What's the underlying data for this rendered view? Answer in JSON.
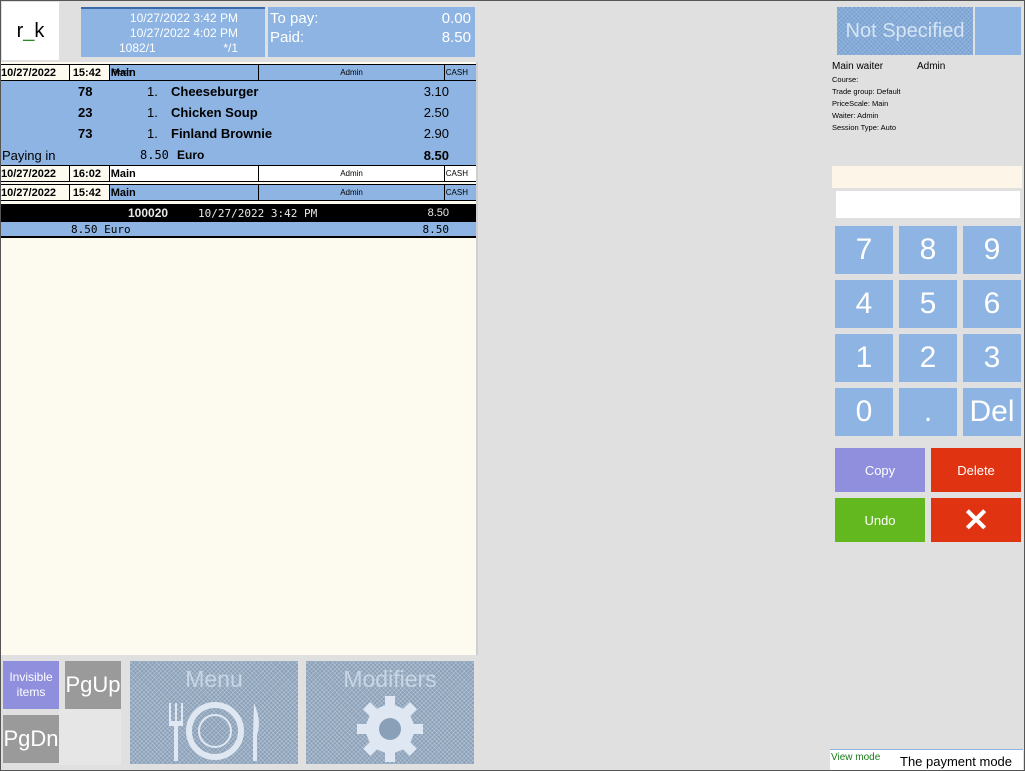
{
  "header": {
    "logo": {
      "left": "r",
      "underscore": "_",
      "right": "k"
    },
    "order_info": {
      "opened": "10/27/2022 3:42 PM",
      "closed": "10/27/2022 4:02 PM",
      "order_number": "1082/1",
      "guests": "*/1"
    },
    "payment": {
      "to_pay_label": "To pay:",
      "to_pay_value": "0.00",
      "paid_label": "Paid:",
      "paid_value": "8.50"
    }
  },
  "order": {
    "rows": [
      {
        "date": "10/27/2022",
        "time": "15:42",
        "status": "Ready",
        "menu": "Main",
        "waiter": "Admin",
        "payment": "CASH"
      },
      {
        "date": "10/27/2022",
        "time": "16:02",
        "status": "",
        "menu": "Main",
        "waiter": "Admin",
        "payment": "CASH"
      },
      {
        "date": "10/27/2022",
        "time": "15:42",
        "status": "",
        "menu": "Main",
        "waiter": "Admin",
        "payment": "CASH"
      }
    ],
    "items": [
      {
        "code": "78",
        "qty": "1.",
        "name": "Cheeseburger",
        "price": "3.10"
      },
      {
        "code": "23",
        "qty": "1.",
        "name": "Chicken Soup",
        "price": "2.50"
      },
      {
        "code": "73",
        "qty": "1.",
        "name": "Finland Brownie",
        "price": "2.90"
      }
    ],
    "paying_in": {
      "label": "Paying in",
      "amount": "8.50",
      "currency": "Euro",
      "total": "8.50"
    },
    "receipt": {
      "number": "100020",
      "datetime": "10/27/2022 3:42 PM",
      "amount": "8.50"
    },
    "receipt_total": {
      "amount": "8.50 Euro",
      "total": "8.50"
    }
  },
  "bottom": {
    "invisible_items": "Invisible items",
    "pgup": "PgUp",
    "pgdn": "PgDn",
    "menu": "Menu",
    "modifiers": "Modifiers"
  },
  "right": {
    "guest_type": "Not Specified",
    "main_waiter_label": "Main waiter",
    "main_waiter_value": "Admin",
    "course": "Course:",
    "trade_group": "Trade group: Default",
    "price_scale": "PriceScale: Main",
    "waiter": "Waiter: Admin",
    "session_type": "Session Type: Auto",
    "keypad": [
      "7",
      "8",
      "9",
      "4",
      "5",
      "6",
      "1",
      "2",
      "3",
      "0",
      ".",
      "Del"
    ],
    "copy": "Copy",
    "delete": "Delete",
    "undo": "Undo",
    "close": "✕",
    "view_mode": "View mode",
    "payment_mode": "The payment mode"
  },
  "colors": {
    "panel_blue": "#8db4e2",
    "copy_purple": "#8f8fde",
    "delete_red": "#e03312",
    "undo_green": "#62b81e",
    "order_bg": "#fdfaf0"
  }
}
